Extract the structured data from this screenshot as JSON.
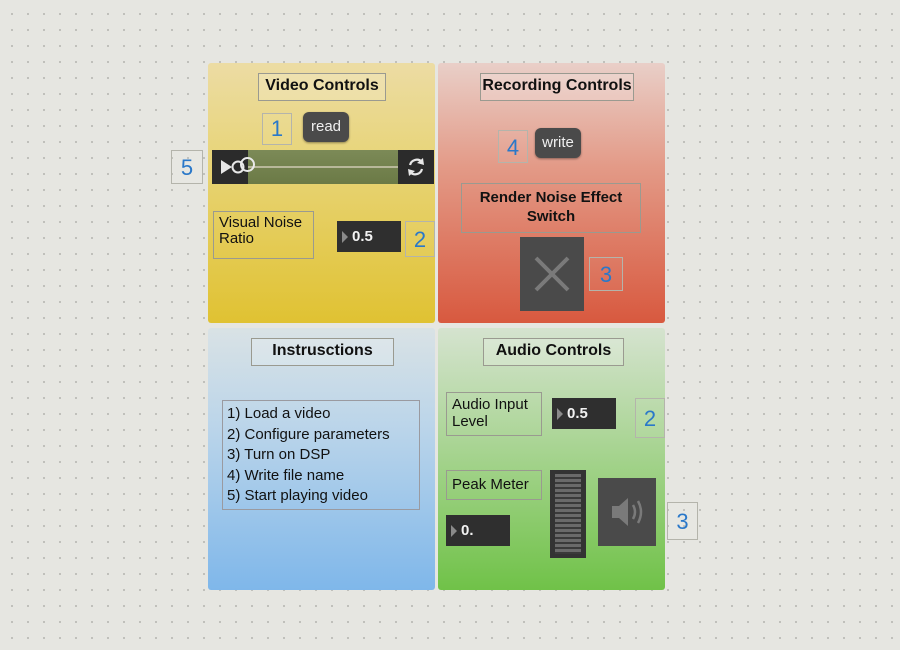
{
  "video_controls": {
    "title": "Video Controls",
    "read_label": "read",
    "read_step": "1",
    "player_step": "5",
    "noise_label_line1": "Visual Noise",
    "noise_label_line2": "Ratio",
    "noise_value": "0.5",
    "noise_step": "2",
    "player_position": 0.0
  },
  "recording_controls": {
    "title": "Recording Controls",
    "write_label": "write",
    "write_step": "4",
    "render_label_line1": "Render Noise Effect",
    "render_label_line2": "Switch",
    "render_step": "3"
  },
  "instructions": {
    "title": "Instrusctions",
    "steps": [
      "1) Load a video",
      "2) Configure parameters",
      "3) Turn on DSP",
      "4) Write file name",
      "5) Start playing video"
    ]
  },
  "audio_controls": {
    "title": "Audio Controls",
    "input_label_line1": "Audio Input",
    "input_label_line2": "Level",
    "input_value": "0.5",
    "input_step": "2",
    "peak_label": "Peak Meter",
    "peak_value": "0.",
    "speaker_step": "3"
  },
  "icons": {
    "play": "play-icon",
    "loop": "loop-icon",
    "toggle": "x-toggle-icon",
    "speaker": "speaker-icon"
  }
}
